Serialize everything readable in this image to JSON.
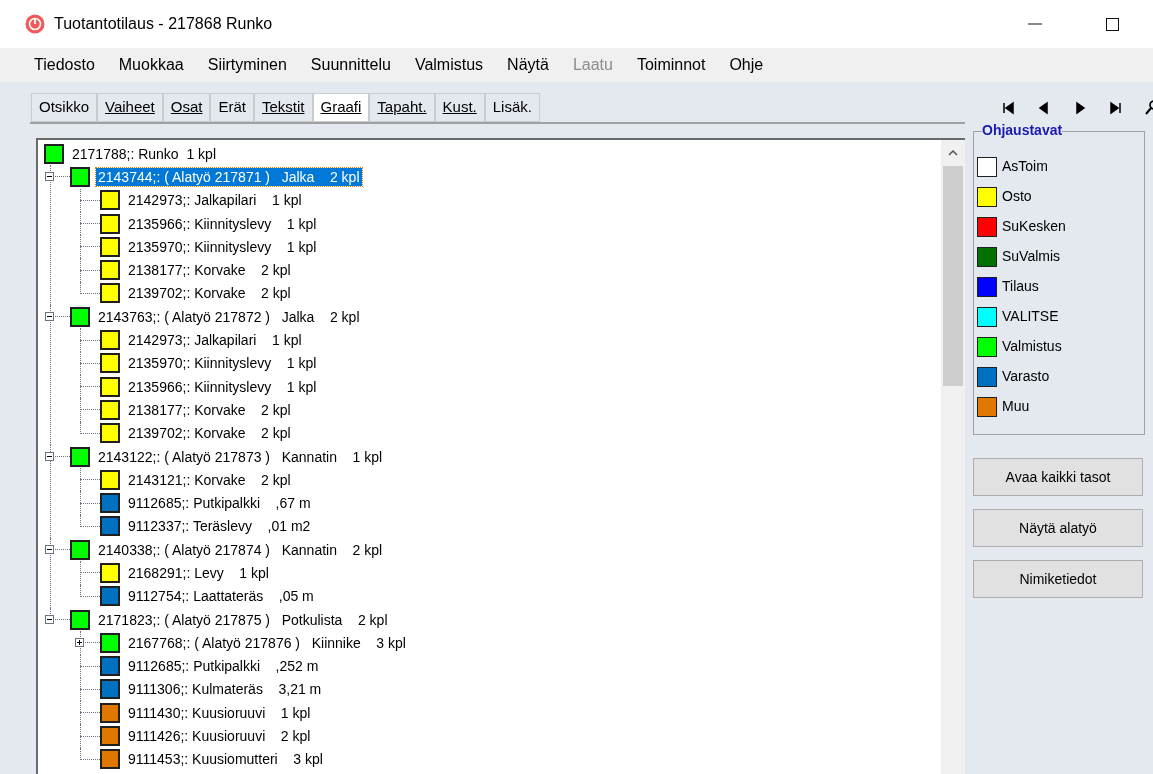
{
  "window": {
    "title": "Tuotantotilaus - 217868 Runko"
  },
  "menu": [
    {
      "label": "Tiedosto",
      "disabled": false
    },
    {
      "label": "Muokkaa",
      "disabled": false
    },
    {
      "label": "Siirtyminen",
      "disabled": false
    },
    {
      "label": "Suunnittelu",
      "disabled": false
    },
    {
      "label": "Valmistus",
      "disabled": false
    },
    {
      "label": "Näytä",
      "disabled": false
    },
    {
      "label": "Laatu",
      "disabled": true
    },
    {
      "label": "Toiminnot",
      "disabled": false
    },
    {
      "label": "Ohje",
      "disabled": false
    }
  ],
  "tabs": [
    {
      "label": "Otsikko",
      "underlined": false,
      "selected": false
    },
    {
      "label": "Vaiheet",
      "underlined": true,
      "selected": false
    },
    {
      "label": "Osat",
      "underlined": true,
      "selected": false
    },
    {
      "label": "Erät",
      "underlined": false,
      "selected": false
    },
    {
      "label": "Tekstit",
      "underlined": true,
      "selected": false
    },
    {
      "label": "Graafi",
      "underlined": true,
      "selected": true
    },
    {
      "label": "Tapaht.",
      "underlined": true,
      "selected": false
    },
    {
      "label": "Kust.",
      "underlined": true,
      "selected": false
    },
    {
      "label": "Lisäk.",
      "underlined": false,
      "selected": false
    }
  ],
  "tree": {
    "label": "2171788;: Runko  1 kpl",
    "color": "#00ff00",
    "selected": false,
    "children": [
      {
        "label": "2143744;: ( Alatyö 217871 )   Jalka    2 kpl",
        "color": "#00ff00",
        "selected": true,
        "expanded": true,
        "children": [
          {
            "label": "2142973;: Jalkapilari    1 kpl",
            "color": "#ffff00",
            "selected": false
          },
          {
            "label": "2135966;: Kiinnityslevy    1 kpl",
            "color": "#ffff00",
            "selected": false
          },
          {
            "label": "2135970;: Kiinnityslevy    1 kpl",
            "color": "#ffff00",
            "selected": false
          },
          {
            "label": "2138177;: Korvake    2 kpl",
            "color": "#ffff00",
            "selected": false
          },
          {
            "label": "2139702;: Korvake    2 kpl",
            "color": "#ffff00",
            "selected": false
          }
        ]
      },
      {
        "label": "2143763;: ( Alatyö 217872 )   Jalka    2 kpl",
        "color": "#00ff00",
        "selected": false,
        "expanded": true,
        "children": [
          {
            "label": "2142973;: Jalkapilari    1 kpl",
            "color": "#ffff00",
            "selected": false
          },
          {
            "label": "2135970;: Kiinnityslevy    1 kpl",
            "color": "#ffff00",
            "selected": false
          },
          {
            "label": "2135966;: Kiinnityslevy    1 kpl",
            "color": "#ffff00",
            "selected": false
          },
          {
            "label": "2138177;: Korvake    2 kpl",
            "color": "#ffff00",
            "selected": false
          },
          {
            "label": "2139702;: Korvake    2 kpl",
            "color": "#ffff00",
            "selected": false
          }
        ]
      },
      {
        "label": "2143122;: ( Alatyö 217873 )   Kannatin    1 kpl",
        "color": "#00ff00",
        "selected": false,
        "expanded": true,
        "children": [
          {
            "label": "2143121;: Korvake    2 kpl",
            "color": "#ffff00",
            "selected": false
          },
          {
            "label": "9112685;: Putkipalkki    ,67 m",
            "color": "#0070c0",
            "selected": false
          },
          {
            "label": "9112337;: Teräslevy    ,01 m2",
            "color": "#0070c0",
            "selected": false
          }
        ]
      },
      {
        "label": "2140338;: ( Alatyö 217874 )   Kannatin    2 kpl",
        "color": "#00ff00",
        "selected": false,
        "expanded": true,
        "children": [
          {
            "label": "2168291;: Levy    1 kpl",
            "color": "#ffff00",
            "selected": false
          },
          {
            "label": "9112754;: Laattateräs    ,05 m",
            "color": "#0070c0",
            "selected": false
          }
        ]
      },
      {
        "label": "2171823;: ( Alatyö 217875 )   Potkulista    2 kpl",
        "color": "#00ff00",
        "selected": false,
        "expanded": true,
        "children": [
          {
            "label": "2167768;: ( Alatyö 217876 )   Kiinnike    3 kpl",
            "color": "#00ff00",
            "selected": false,
            "expanded": false
          },
          {
            "label": "9112685;: Putkipalkki    ,252 m",
            "color": "#0070c0",
            "selected": false
          },
          {
            "label": "9111306;: Kulmateräs    3,21 m",
            "color": "#0070c0",
            "selected": false
          },
          {
            "label": "9111430;: Kuusioruuvi    1 kpl",
            "color": "#e07800",
            "selected": false
          },
          {
            "label": "9111426;: Kuusioruuvi    2 kpl",
            "color": "#e07800",
            "selected": false
          },
          {
            "label": "9111453;: Kuusiomutteri    3 kpl",
            "color": "#e07800",
            "selected": false
          }
        ]
      }
    ]
  },
  "legend": {
    "title": "Ohjaustavat",
    "items": [
      {
        "label": "AsToim",
        "color": "#ffffff"
      },
      {
        "label": "Osto",
        "color": "#ffff00"
      },
      {
        "label": "SuKesken",
        "color": "#ff0000"
      },
      {
        "label": "SuValmis",
        "color": "#007000"
      },
      {
        "label": "Tilaus",
        "color": "#0000ff"
      },
      {
        "label": "VALITSE",
        "color": "#00ffff"
      },
      {
        "label": "Valmistus",
        "color": "#00ff00"
      },
      {
        "label": "Varasto",
        "color": "#0070c0"
      },
      {
        "label": "Muu",
        "color": "#e07800"
      }
    ]
  },
  "buttons": [
    "Avaa kaikki tasot",
    "Näytä alatyö",
    "Nimiketiedot"
  ]
}
